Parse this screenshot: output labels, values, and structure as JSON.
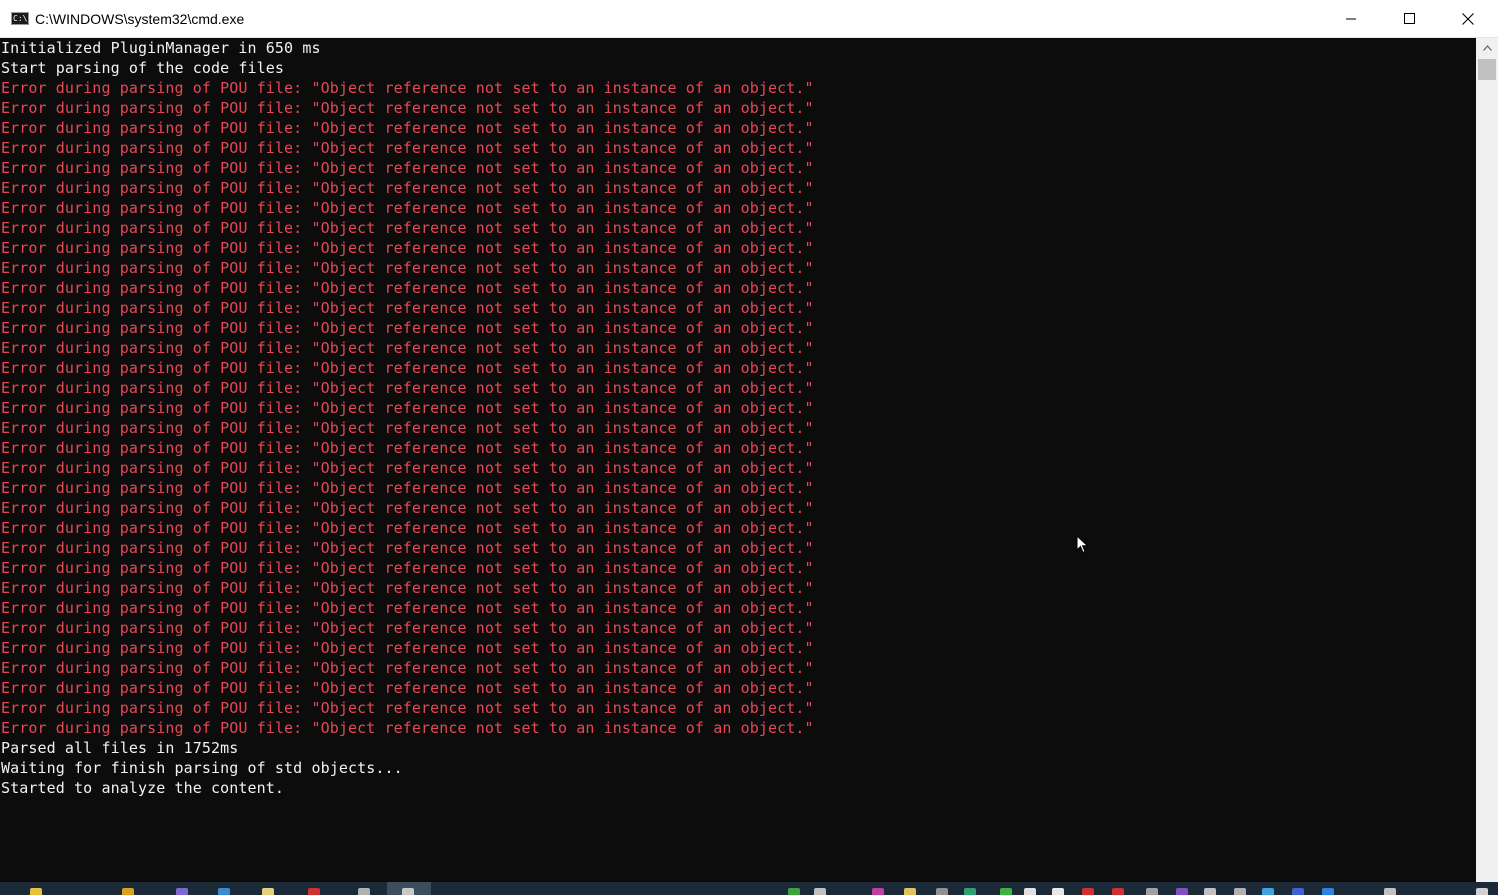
{
  "window": {
    "title": "C:\\WINDOWS\\system32\\cmd.exe",
    "icon_label": "C:\\."
  },
  "controls": {
    "minimize_icon": "minimize-icon",
    "maximize_icon": "maximize-icon",
    "close_icon": "close-icon"
  },
  "console": {
    "lines": [
      {
        "text": "Initialized PluginManager in 650 ms",
        "color": "#f2f2f2"
      },
      {
        "text": "Start parsing of the code files",
        "color": "#f2f2f2"
      },
      {
        "text": "Error during parsing of POU file: \"Object reference not set to an instance of an object.\"",
        "color": "#e74856"
      },
      {
        "text": "Error during parsing of POU file: \"Object reference not set to an instance of an object.\"",
        "color": "#e74856"
      },
      {
        "text": "Error during parsing of POU file: \"Object reference not set to an instance of an object.\"",
        "color": "#e74856"
      },
      {
        "text": "Error during parsing of POU file: \"Object reference not set to an instance of an object.\"",
        "color": "#e74856"
      },
      {
        "text": "Error during parsing of POU file: \"Object reference not set to an instance of an object.\"",
        "color": "#e74856"
      },
      {
        "text": "Error during parsing of POU file: \"Object reference not set to an instance of an object.\"",
        "color": "#e74856"
      },
      {
        "text": "Error during parsing of POU file: \"Object reference not set to an instance of an object.\"",
        "color": "#e74856"
      },
      {
        "text": "Error during parsing of POU file: \"Object reference not set to an instance of an object.\"",
        "color": "#e74856"
      },
      {
        "text": "Error during parsing of POU file: \"Object reference not set to an instance of an object.\"",
        "color": "#e74856"
      },
      {
        "text": "Error during parsing of POU file: \"Object reference not set to an instance of an object.\"",
        "color": "#e74856"
      },
      {
        "text": "Error during parsing of POU file: \"Object reference not set to an instance of an object.\"",
        "color": "#e74856"
      },
      {
        "text": "Error during parsing of POU file: \"Object reference not set to an instance of an object.\"",
        "color": "#e74856"
      },
      {
        "text": "Error during parsing of POU file: \"Object reference not set to an instance of an object.\"",
        "color": "#e74856"
      },
      {
        "text": "Error during parsing of POU file: \"Object reference not set to an instance of an object.\"",
        "color": "#e74856"
      },
      {
        "text": "Error during parsing of POU file: \"Object reference not set to an instance of an object.\"",
        "color": "#e74856"
      },
      {
        "text": "Error during parsing of POU file: \"Object reference not set to an instance of an object.\"",
        "color": "#e74856"
      },
      {
        "text": "Error during parsing of POU file: \"Object reference not set to an instance of an object.\"",
        "color": "#e74856"
      },
      {
        "text": "Error during parsing of POU file: \"Object reference not set to an instance of an object.\"",
        "color": "#e74856"
      },
      {
        "text": "Error during parsing of POU file: \"Object reference not set to an instance of an object.\"",
        "color": "#e74856"
      },
      {
        "text": "Error during parsing of POU file: \"Object reference not set to an instance of an object.\"",
        "color": "#e74856"
      },
      {
        "text": "Error during parsing of POU file: \"Object reference not set to an instance of an object.\"",
        "color": "#e74856"
      },
      {
        "text": "Error during parsing of POU file: \"Object reference not set to an instance of an object.\"",
        "color": "#e74856"
      },
      {
        "text": "Error during parsing of POU file: \"Object reference not set to an instance of an object.\"",
        "color": "#e74856"
      },
      {
        "text": "Error during parsing of POU file: \"Object reference not set to an instance of an object.\"",
        "color": "#e74856"
      },
      {
        "text": "Error during parsing of POU file: \"Object reference not set to an instance of an object.\"",
        "color": "#e74856"
      },
      {
        "text": "Error during parsing of POU file: \"Object reference not set to an instance of an object.\"",
        "color": "#e74856"
      },
      {
        "text": "Error during parsing of POU file: \"Object reference not set to an instance of an object.\"",
        "color": "#e74856"
      },
      {
        "text": "Error during parsing of POU file: \"Object reference not set to an instance of an object.\"",
        "color": "#e74856"
      },
      {
        "text": "Error during parsing of POU file: \"Object reference not set to an instance of an object.\"",
        "color": "#e74856"
      },
      {
        "text": "Error during parsing of POU file: \"Object reference not set to an instance of an object.\"",
        "color": "#e74856"
      },
      {
        "text": "Error during parsing of POU file: \"Object reference not set to an instance of an object.\"",
        "color": "#e74856"
      },
      {
        "text": "Error during parsing of POU file: \"Object reference not set to an instance of an object.\"",
        "color": "#e74856"
      },
      {
        "text": "Error during parsing of POU file: \"Object reference not set to an instance of an object.\"",
        "color": "#e74856"
      },
      {
        "text": "Parsed all files in 1752ms",
        "color": "#f2f2f2"
      },
      {
        "text": "Waiting for finish parsing of std objects...",
        "color": "#f2f2f2"
      },
      {
        "text": "Started to analyze the content.",
        "color": "#f2f2f2"
      }
    ]
  },
  "colors": {
    "console_bg": "#0c0c0c",
    "normal_text": "#f2f2f2",
    "error_text": "#e74856",
    "titlebar_bg": "#ffffff",
    "taskbar_bg": "#1c2a38"
  }
}
